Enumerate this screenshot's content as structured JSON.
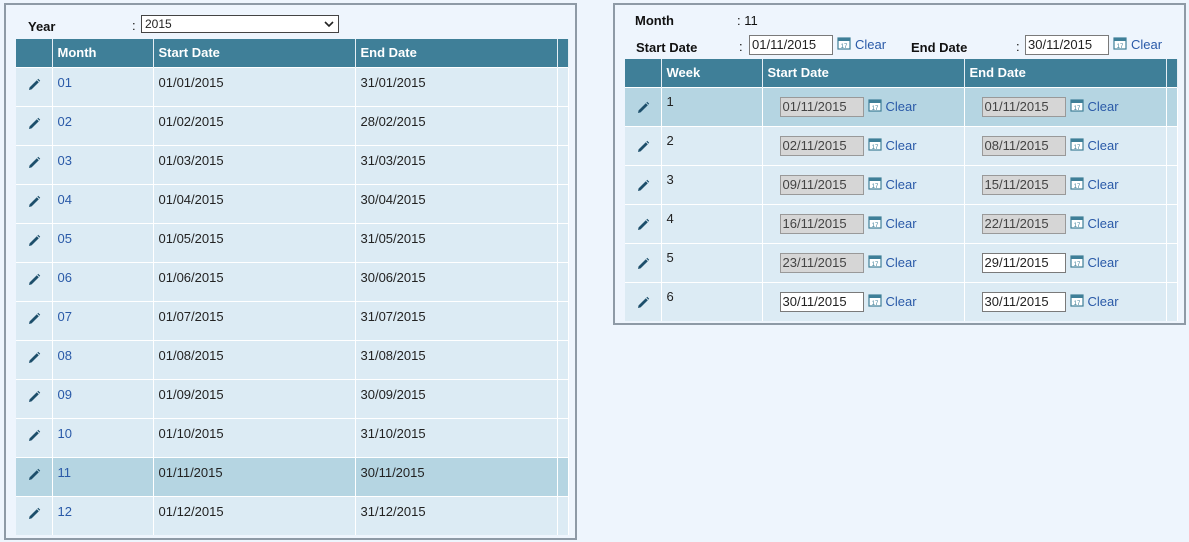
{
  "monthly": {
    "year_label": "Year",
    "colon": ":",
    "year_value": "2015",
    "columns": {
      "month": "Month",
      "start": "Start Date",
      "end": "End Date"
    },
    "rows": [
      {
        "month": "01",
        "start": "01/01/2015",
        "end": "31/01/2015"
      },
      {
        "month": "02",
        "start": "01/02/2015",
        "end": "28/02/2015"
      },
      {
        "month": "03",
        "start": "01/03/2015",
        "end": "31/03/2015"
      },
      {
        "month": "04",
        "start": "01/04/2015",
        "end": "30/04/2015"
      },
      {
        "month": "05",
        "start": "01/05/2015",
        "end": "31/05/2015"
      },
      {
        "month": "06",
        "start": "01/06/2015",
        "end": "30/06/2015"
      },
      {
        "month": "07",
        "start": "01/07/2015",
        "end": "31/07/2015"
      },
      {
        "month": "08",
        "start": "01/08/2015",
        "end": "31/08/2015"
      },
      {
        "month": "09",
        "start": "01/09/2015",
        "end": "30/09/2015"
      },
      {
        "month": "10",
        "start": "01/10/2015",
        "end": "31/10/2015"
      },
      {
        "month": "11",
        "start": "01/11/2015",
        "end": "30/11/2015",
        "selected": true
      },
      {
        "month": "12",
        "start": "01/12/2015",
        "end": "31/12/2015"
      }
    ]
  },
  "weekly": {
    "month_label": "Month",
    "month_value": ": 11",
    "start_label": "Start Date",
    "end_label": "End Date",
    "colon": ":",
    "start_value": "01/11/2015",
    "end_value": "30/11/2015",
    "clear_label": "Clear",
    "columns": {
      "week": "Week",
      "start": "Start Date",
      "end": "End Date"
    },
    "rows": [
      {
        "week": "1",
        "start": "01/11/2015",
        "start_disabled": true,
        "end": "01/11/2015",
        "end_disabled": true,
        "selected": true
      },
      {
        "week": "2",
        "start": "02/11/2015",
        "start_disabled": true,
        "end": "08/11/2015",
        "end_disabled": true
      },
      {
        "week": "3",
        "start": "09/11/2015",
        "start_disabled": true,
        "end": "15/11/2015",
        "end_disabled": true
      },
      {
        "week": "4",
        "start": "16/11/2015",
        "start_disabled": true,
        "end": "22/11/2015",
        "end_disabled": true
      },
      {
        "week": "5",
        "start": "23/11/2015",
        "start_disabled": true,
        "end": "29/11/2015",
        "end_disabled": false
      },
      {
        "week": "6",
        "start": "30/11/2015",
        "start_disabled": false,
        "end": "30/11/2015",
        "end_disabled": false
      }
    ]
  },
  "icons": {
    "edit": "pencil-icon",
    "calendar": "calendar-icon",
    "dropdown": "chevron-down-icon"
  },
  "colors": {
    "header": "#3f7f98",
    "row": "#dcebf4",
    "selected_row": "#b5d5e2",
    "link": "#2a5aa8"
  }
}
